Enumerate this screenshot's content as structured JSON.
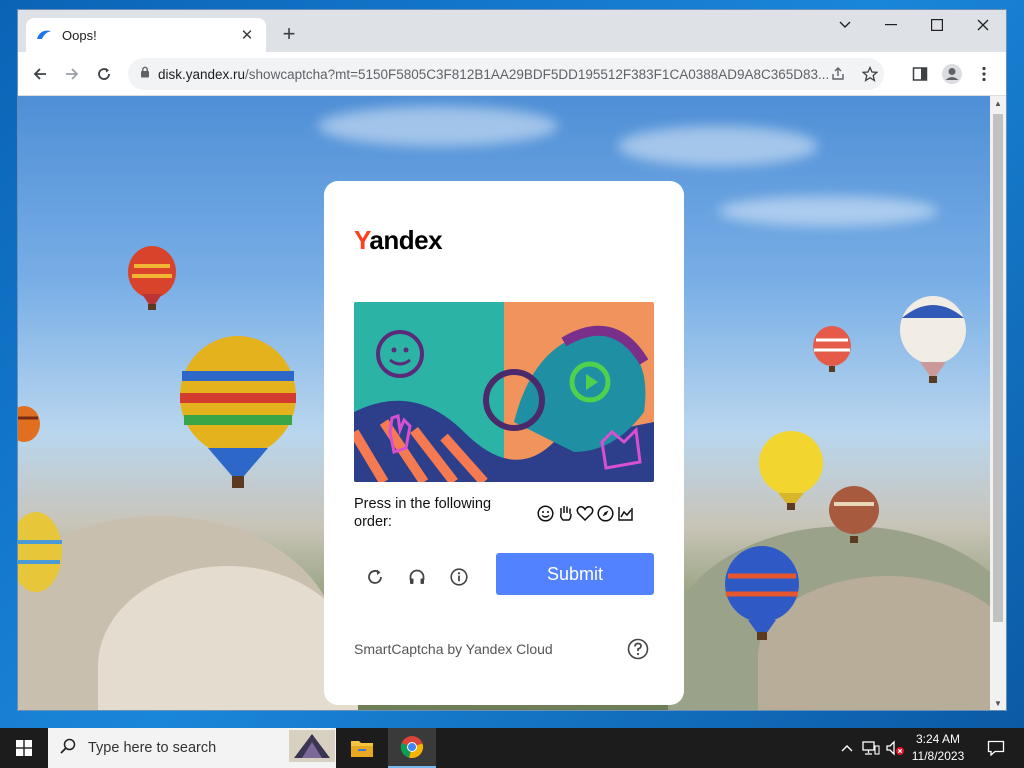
{
  "browser": {
    "tab_title": "Oops!",
    "new_tab_icon": "+",
    "url_domain": "disk.yandex.ru",
    "url_path": "/showcaptcha?mt=5150F5805C3F812B1AA29BDF5DD195512F383F1CA0388AD9A8C365D83..."
  },
  "captcha": {
    "logo_first": "Y",
    "logo_rest": "andex",
    "instruction": "Press in the following order:",
    "submit_label": "Submit",
    "footer": "SmartCaptcha by Yandex Cloud",
    "order_icons": [
      "smiley-icon",
      "hand-icon",
      "heart-icon",
      "compass-icon",
      "chart-icon"
    ],
    "accent_color": "#5282ff",
    "logo_red": "#fc3f1d"
  },
  "taskbar": {
    "search_placeholder": "Type here to search",
    "time": "3:24 AM",
    "date": "11/8/2023"
  }
}
